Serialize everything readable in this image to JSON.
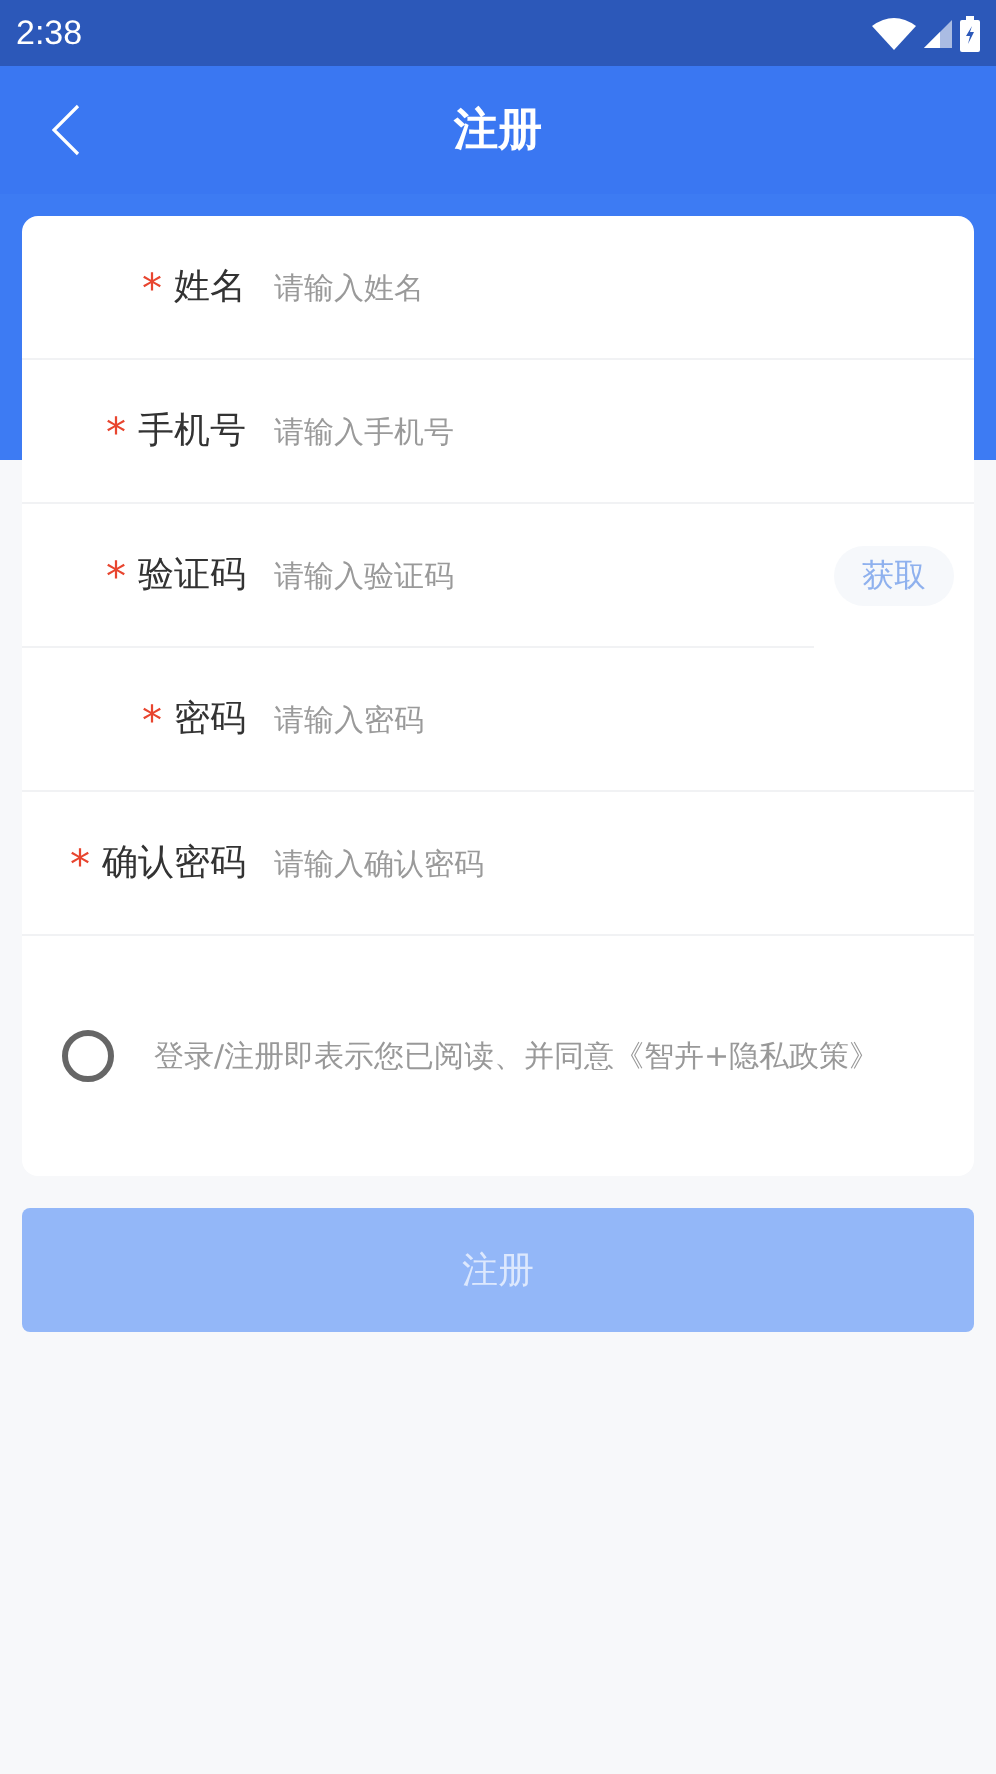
{
  "status_bar": {
    "time": "2:38"
  },
  "header": {
    "title": "注册"
  },
  "fields": [
    {
      "kind": "text",
      "required_mark": "*",
      "label": "姓名",
      "placeholder": "请输入姓名"
    },
    {
      "kind": "text",
      "required_mark": "*",
      "label": "手机号",
      "placeholder": "请输入手机号"
    },
    {
      "kind": "code",
      "required_mark": "*",
      "label": "验证码",
      "placeholder": "请输入验证码",
      "action": "获取"
    },
    {
      "kind": "password",
      "required_mark": "*",
      "label": "密码",
      "placeholder": "请输入密码"
    },
    {
      "kind": "password",
      "required_mark": "*",
      "label": "确认密码",
      "placeholder": "请输入确认密码"
    }
  ],
  "agreement": {
    "checked": false,
    "text": "登录/注册即表示您已阅读、并同意《智卉+隐私政策》"
  },
  "submit": {
    "label": "注册",
    "disabled": true
  }
}
